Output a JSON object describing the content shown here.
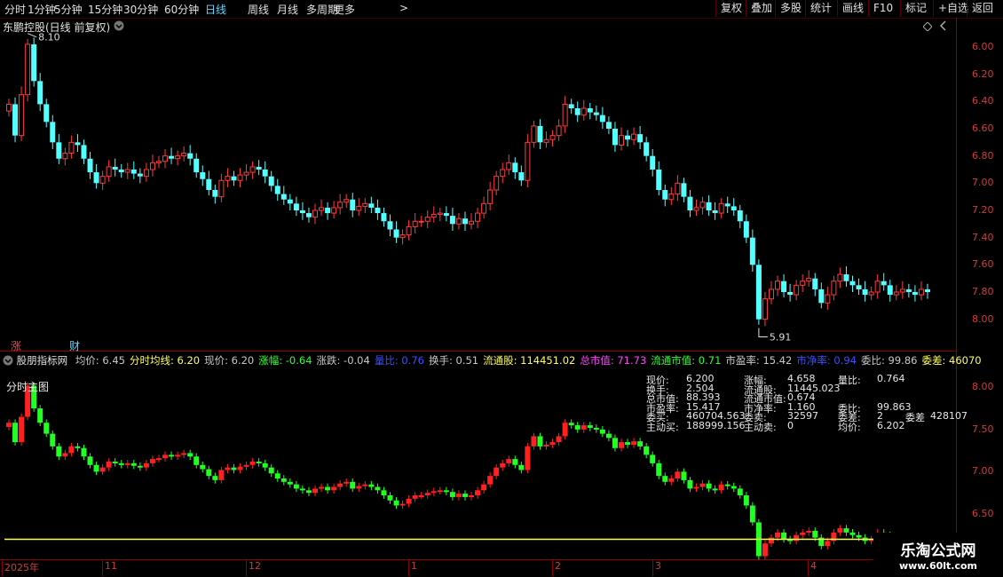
{
  "toolbar": {
    "timeframes": [
      "分时",
      "1分钟",
      "5分钟",
      "15分钟",
      "30分钟",
      "60分钟",
      "日线",
      "周线",
      "月线",
      "多周期",
      "更多"
    ],
    "active": "日线",
    "buttons": [
      "复权",
      "叠加",
      "多股",
      "统计",
      "画线",
      "F10",
      "标记",
      "+自选",
      "返回"
    ]
  },
  "main_panel": {
    "title": "东鹏控股(日线 前复权)",
    "high_label": "8.10",
    "low_label": "5.91",
    "y_ticks": [
      "8.00",
      "7.80",
      "7.60",
      "7.40",
      "7.20",
      "7.00",
      "6.80",
      "6.60",
      "6.40",
      "6.20",
      "6.00"
    ],
    "markers": [
      "涨",
      "财"
    ],
    "colors": {
      "up": "#ff3c3c",
      "down": "#54ffff"
    }
  },
  "indicator_panel": {
    "source": "股朋指标网",
    "stats": [
      {
        "label": "均价:",
        "value": "6.45",
        "color": "#c8c8c8"
      },
      {
        "label": "分时均线:",
        "value": "6.20",
        "color": "#ffff55"
      },
      {
        "label": "现价:",
        "value": "6.20",
        "color": "#c8c8c8"
      },
      {
        "label": "涨幅:",
        "value": "-0.64",
        "color": "#33ff33"
      },
      {
        "label": "涨跌:",
        "value": "-0.04",
        "color": "#c8c8c8"
      },
      {
        "label": "量比:",
        "value": "0.76",
        "color": "#3c50ff"
      },
      {
        "label": "换手:",
        "value": "0.51",
        "color": "#c8c8c8"
      },
      {
        "label": "流通股:",
        "value": "114451.02",
        "color": "#ffff55"
      },
      {
        "label": "总市值:",
        "value": "71.73",
        "color": "#ff44ff"
      },
      {
        "label": "流通市值:",
        "value": "0.71",
        "color": "#33ff33"
      },
      {
        "label": "市盈率:",
        "value": "15.42",
        "color": "#c8c8c8"
      },
      {
        "label": "市净率:",
        "value": "0.94",
        "color": "#3c50ff"
      },
      {
        "label": "委比:",
        "value": "99.86",
        "color": "#c8c8c8"
      },
      {
        "label": "委差:",
        "value": "46070",
        "color": "#ffff55"
      }
    ],
    "overlay_label": "分时主图",
    "y_ticks": [
      "8.00",
      "7.50",
      "7.00",
      "6.50"
    ],
    "info_rows": [
      [
        "现价:",
        "6.200",
        "涨幅:",
        "4.658",
        "量比:",
        "0.764"
      ],
      [
        "换手:",
        "2.504",
        "流通股:",
        "11445.023",
        ""
      ],
      [
        "总市值:",
        "88.393",
        "流通市值:",
        "0.674",
        ""
      ],
      [
        "市盈率:",
        "15.417",
        "市净率:",
        "1.160",
        "委比:",
        "99.863"
      ],
      [
        "委买:",
        "460704.563",
        "委卖:",
        "32597",
        "委差:",
        "2",
        "委差",
        "428107"
      ],
      [
        "主动买:",
        "188999.156",
        "主动卖:",
        "0",
        "均价:",
        "6.202"
      ]
    ],
    "colors": {
      "up": "#ff2020",
      "down": "#22ff22",
      "avg_line": "#ffff55"
    }
  },
  "x_axis": {
    "labels": [
      "2025年",
      "11",
      "12",
      "1",
      "2",
      "3",
      "4"
    ]
  },
  "watermark": {
    "name": "乐淘公式网",
    "url": "www.60lt.com"
  },
  "chart_data": {
    "type": "candlestick",
    "ylim": [
      5.9,
      8.15
    ],
    "y_ticks": [
      6.0,
      6.2,
      6.4,
      6.6,
      6.8,
      7.0,
      7.2,
      7.4,
      7.6,
      7.8,
      8.0
    ],
    "closes": [
      7.58,
      7.35,
      7.65,
      8.02,
      7.75,
      7.58,
      7.45,
      7.3,
      7.18,
      7.22,
      7.3,
      7.28,
      7.18,
      7.08,
      7.0,
      7.05,
      7.12,
      7.1,
      7.08,
      7.1,
      7.07,
      7.05,
      7.1,
      7.15,
      7.16,
      7.2,
      7.18,
      7.2,
      7.22,
      7.18,
      7.08,
      7.03,
      6.95,
      6.9,
      7.02,
      7.05,
      7.02,
      7.06,
      7.08,
      7.12,
      7.1,
      7.05,
      6.98,
      6.92,
      6.88,
      6.85,
      6.8,
      6.78,
      6.75,
      6.8,
      6.82,
      6.78,
      6.82,
      6.86,
      6.88,
      6.8,
      6.83,
      6.85,
      6.82,
      6.78,
      6.72,
      6.66,
      6.6,
      6.62,
      6.68,
      6.72,
      6.72,
      6.75,
      6.77,
      6.78,
      6.76,
      6.7,
      6.74,
      6.7,
      6.72,
      6.78,
      6.85,
      6.95,
      7.05,
      7.1,
      7.15,
      7.08,
      7.02,
      7.3,
      7.42,
      7.3,
      7.32,
      7.35,
      7.42,
      7.58,
      7.55,
      7.5,
      7.55,
      7.52,
      7.5,
      7.45,
      7.4,
      7.28,
      7.35,
      7.32,
      7.36,
      7.3,
      7.2,
      7.1,
      6.95,
      6.88,
      6.92,
      7.0,
      6.9,
      6.8,
      6.82,
      6.86,
      6.8,
      6.78,
      6.85,
      6.83,
      6.8,
      6.72,
      6.6,
      6.4,
      6.0,
      6.15,
      6.22,
      6.28,
      6.2,
      6.18,
      6.25,
      6.28,
      6.3,
      6.22,
      6.12,
      6.18,
      6.28,
      6.33,
      6.28,
      6.25,
      6.22,
      6.18,
      6.2,
      6.28,
      6.25,
      6.18,
      6.2,
      6.22,
      6.2,
      6.18,
      6.22,
      6.2
    ]
  }
}
